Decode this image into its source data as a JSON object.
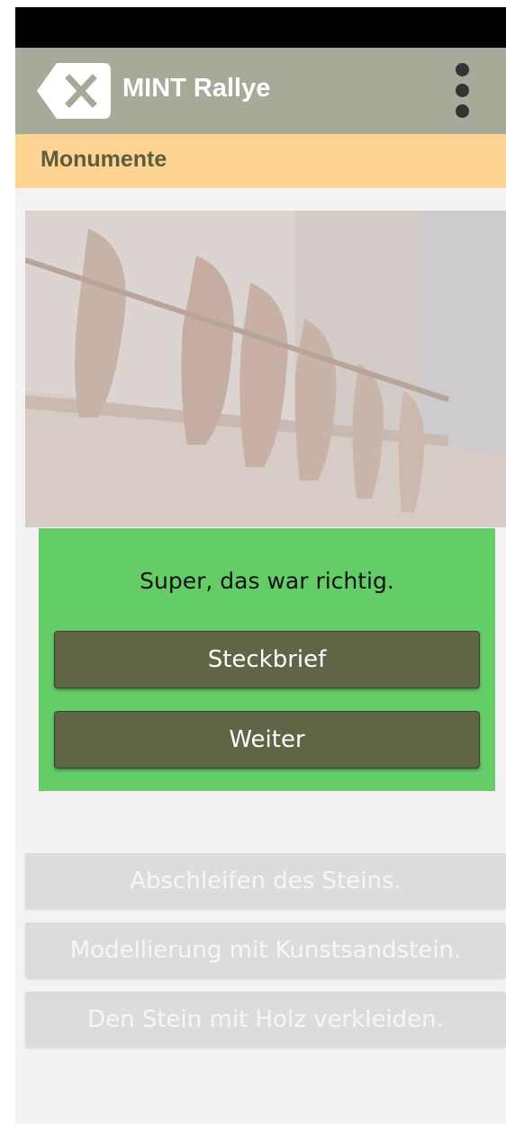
{
  "app": {
    "title": "MINT Rallye"
  },
  "toolbar": {
    "close_icon": "close-icon",
    "menu_icon": "more-vertical-icon"
  },
  "section": {
    "title": "Monumente"
  },
  "feedback": {
    "message": "Super, das war richtig.",
    "primary_label": "Steckbrief",
    "secondary_label": "Weiter",
    "panel_color": "#64cd68",
    "button_color": "#5e6645"
  },
  "answers": [
    {
      "label": "Abschleifen des Steins."
    },
    {
      "label": "Modellierung mit Kunstsandstein."
    },
    {
      "label": "Den Stein mit Holz verkleiden."
    }
  ],
  "colors": {
    "app_bar": "#a7aa98",
    "section_bar": "#fed493",
    "section_text": "#5a5e3a",
    "answer_bg": "#dcdcdc"
  }
}
